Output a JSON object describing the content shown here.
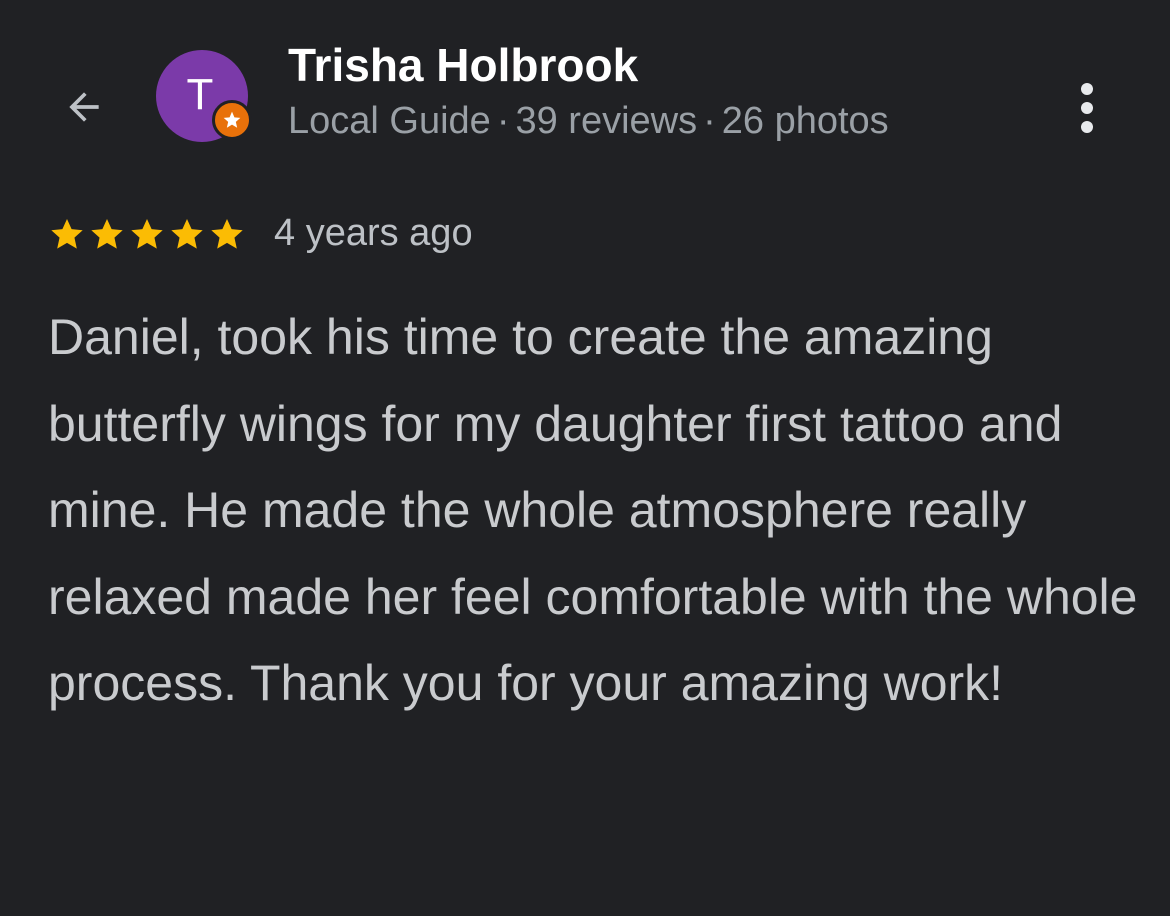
{
  "header": {
    "back_icon": "arrow-back-icon",
    "more_icon": "more-vert-icon"
  },
  "reviewer": {
    "avatar_letter": "T",
    "avatar_color": "#7b3aa9",
    "badge_color": "#e8710a",
    "badge_icon": "local-guide-star-icon",
    "name": "Trisha Holbrook",
    "level": "Local Guide",
    "reviews": "39 reviews",
    "photos": "26 photos",
    "separator": "·"
  },
  "review": {
    "rating": 5,
    "rating_max": 5,
    "star_color": "#fbbc04",
    "time": "4 years ago",
    "text": "Daniel, took his time to create the amazing butterfly wings for my daughter first tattoo and mine. He made the whole atmosphere really relaxed made her feel comfortable with the whole process. Thank you for your amazing work!"
  }
}
